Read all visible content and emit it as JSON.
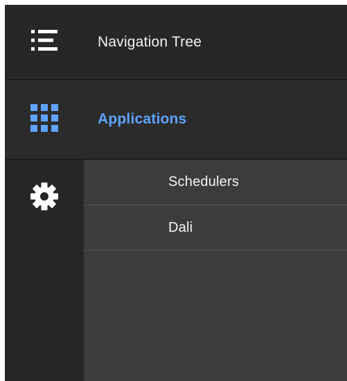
{
  "nav": {
    "tree": {
      "label": "Navigation Tree",
      "icon": "list-icon"
    },
    "apps": {
      "label": "Applications",
      "icon": "grid-icon",
      "active_color": "#5fa3ff"
    },
    "settings": {
      "icon": "gear-icon"
    }
  },
  "submenu": {
    "items": [
      {
        "label": "Schedulers"
      },
      {
        "label": "Dali"
      }
    ]
  }
}
